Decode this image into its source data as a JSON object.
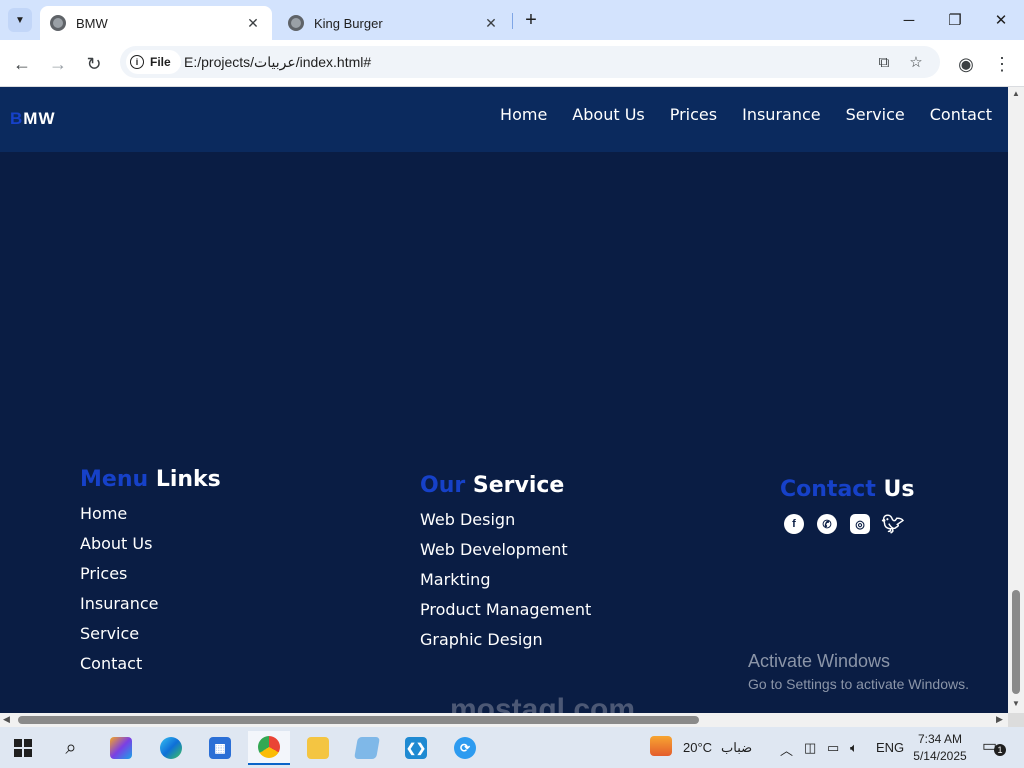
{
  "browser": {
    "tabs": [
      {
        "title": "BMW",
        "active": true
      },
      {
        "title": "King Burger",
        "active": false
      }
    ],
    "chip_label": "File",
    "url": "E:/projects/عربيات/index.html#"
  },
  "site": {
    "logo": {
      "accent": "B",
      "rest": "MW"
    },
    "nav": [
      "Home",
      "About Us",
      "Prices",
      "Insurance",
      "Service",
      "Contact"
    ]
  },
  "footer": {
    "menu": {
      "title_accent": "Menu",
      "title_rest": "Links",
      "links": [
        "Home",
        "About Us",
        "Prices",
        "Insurance",
        "Service",
        "Contact"
      ]
    },
    "service": {
      "title_accent": "Our",
      "title_rest": "Service",
      "links": [
        "Web Design",
        "Web Development",
        "Markting",
        "Product Management",
        "Graphic Design"
      ]
    },
    "contact": {
      "title_accent": "Contact",
      "title_rest": "Us",
      "socials": [
        "facebook-icon",
        "whatsapp-icon",
        "instagram-icon",
        "twitter-icon"
      ]
    }
  },
  "overlay": {
    "activate_title": "Activate Windows",
    "activate_sub": "Go to Settings to activate Windows.",
    "watermark": "mostaql.com"
  },
  "taskbar": {
    "weather_temp": "20°C",
    "weather_desc": "ضباب",
    "language": "ENG",
    "time": "7:34 AM",
    "date": "5/14/2025",
    "notification_count": "1"
  },
  "colors": {
    "accent": "#1641c8",
    "header_bg": "#0b2a5e",
    "page_bg": "#0a1d44"
  }
}
